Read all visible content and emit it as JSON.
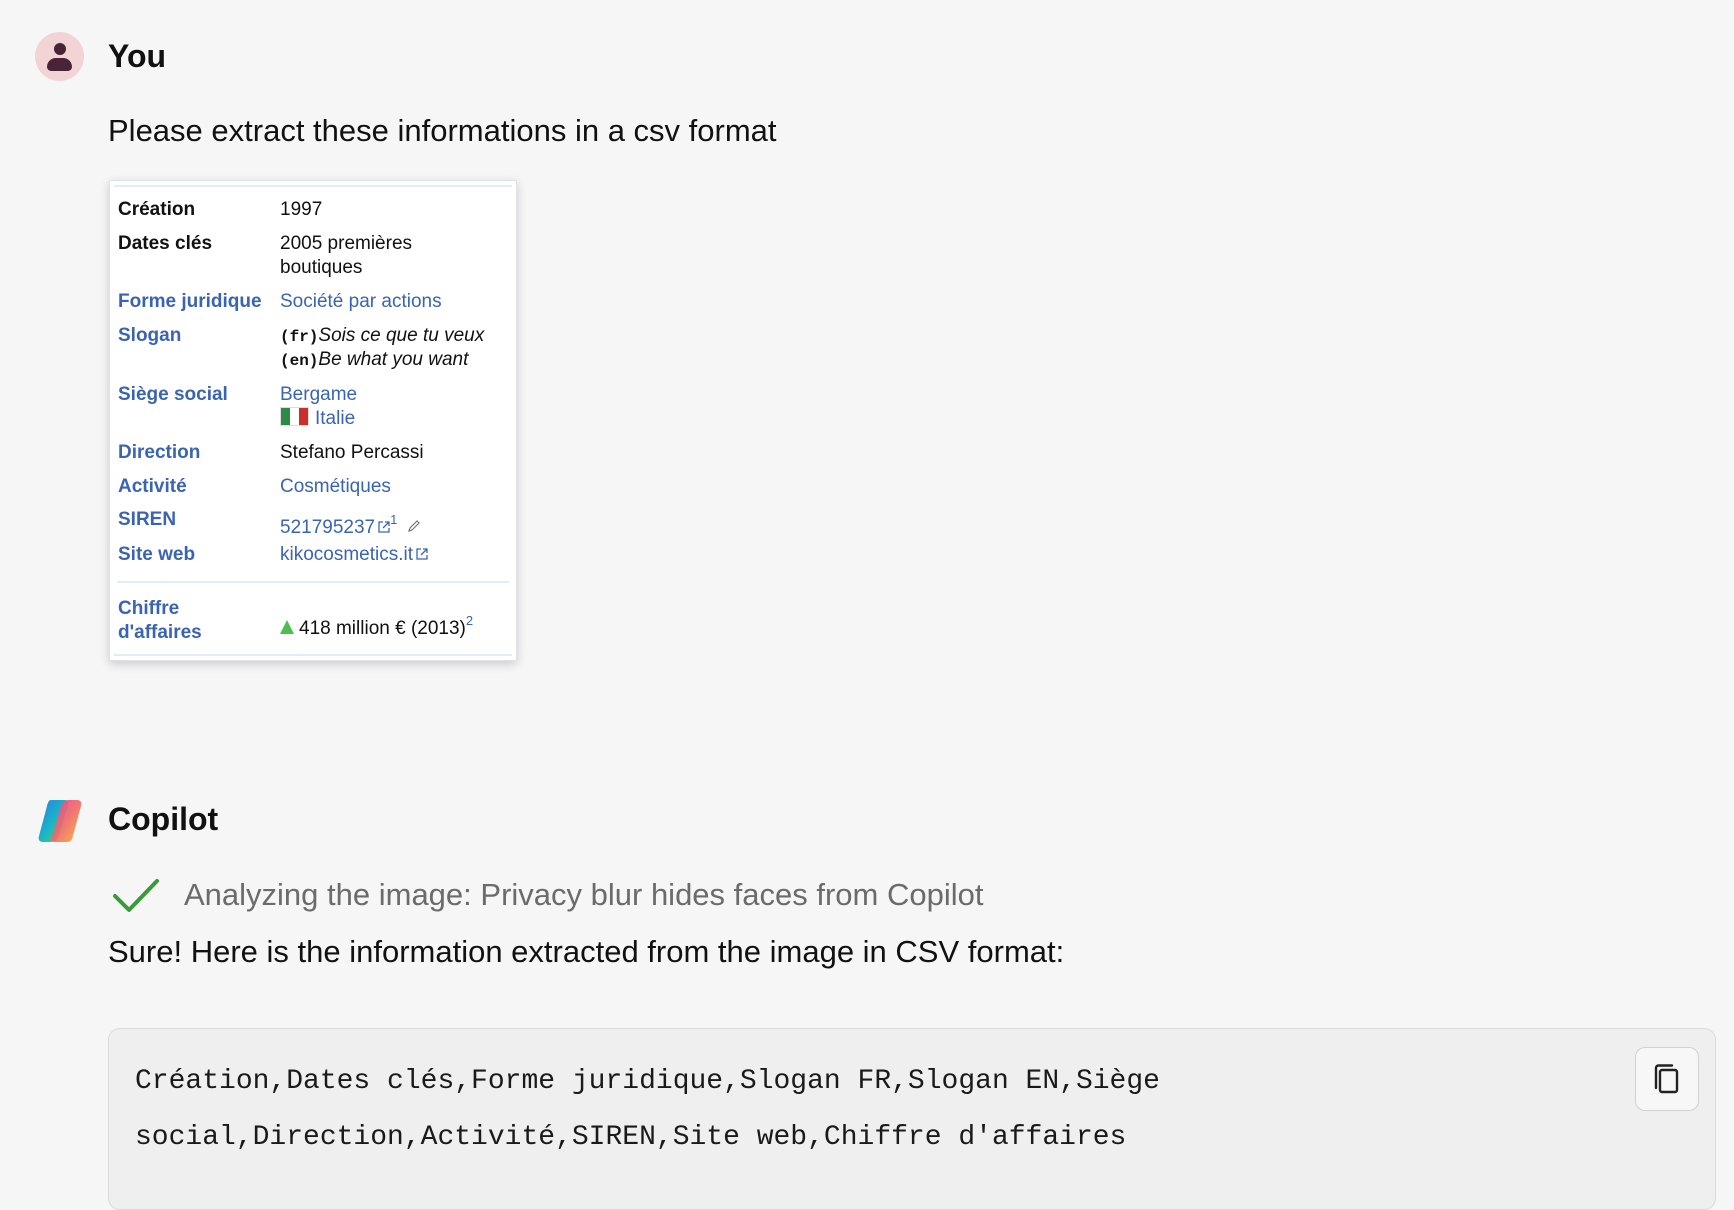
{
  "user": {
    "name": "You",
    "message": "Please extract these informations in a csv format"
  },
  "infobox": {
    "rows": [
      {
        "label": "Création",
        "value": "1997"
      },
      {
        "label": "Dates clés",
        "value_line1": "2005 premières",
        "value_line2": "boutiques"
      },
      {
        "label": "Forme juridique",
        "value": "Société par actions"
      },
      {
        "label": "Slogan",
        "fr_tag": "(fr)",
        "fr_value": "Sois ce que tu veux",
        "en_tag": "(en)",
        "en_value": "Be what you want"
      },
      {
        "label": "Siège social",
        "value_line1": "Bergame",
        "value_line2": "Italie"
      },
      {
        "label": "Direction",
        "value": "Stefano Percassi"
      },
      {
        "label": "Activité",
        "value": "Cosmétiques"
      },
      {
        "label": "SIREN",
        "value": "521795237",
        "sup": "1"
      },
      {
        "label": "Site web",
        "value": "kikocosmetics.it"
      },
      {
        "label_line1": "Chiffre",
        "label_line2": "d'affaires",
        "value": "418 million € (2013)",
        "sup": "2"
      }
    ]
  },
  "copilot": {
    "name": "Copilot",
    "status": "Analyzing the image: Privacy blur hides faces from Copilot",
    "intro": "Sure! Here is the information extracted from the image in CSV format:",
    "code_line1": "Création,Dates clés,Forme juridique,Slogan FR,Slogan EN,Siège",
    "code_line2": "social,Direction,Activité,SIREN,Site web,Chiffre d'affaires"
  },
  "colors": {
    "background": "#f6f6f6",
    "link": "#3a64b3",
    "avatar_bg": "#f2d3d6",
    "check": "#3a9a3a"
  },
  "icons": [
    "user-avatar-icon",
    "copilot-logo-icon",
    "check-icon",
    "copy-icon",
    "external-link-icon",
    "pencil-icon",
    "italy-flag-icon",
    "up-triangle-icon"
  ]
}
